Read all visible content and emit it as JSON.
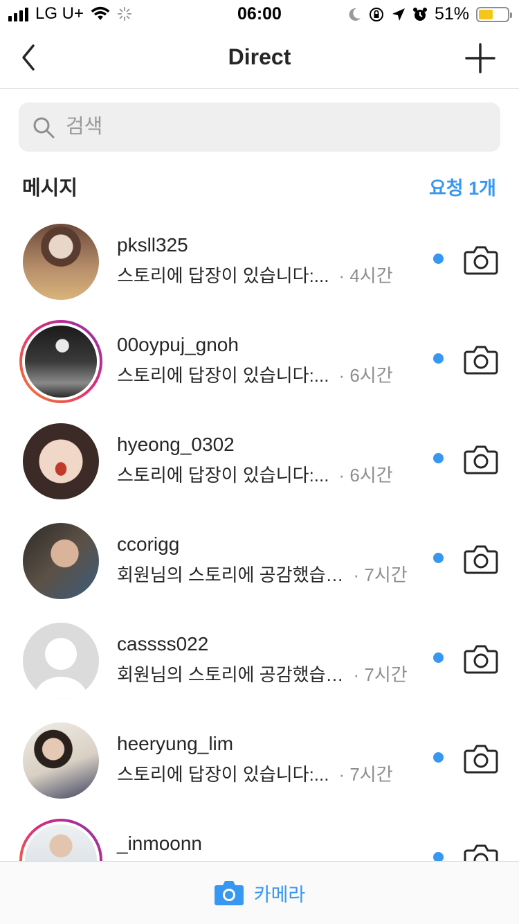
{
  "status_bar": {
    "carrier": "LG U+",
    "time": "06:00",
    "battery": "51%",
    "battery_level": 0.51
  },
  "header": {
    "title": "Direct",
    "back_icon": "chevron-left-icon",
    "add_icon": "plus-icon"
  },
  "search": {
    "placeholder": "검색",
    "value": ""
  },
  "section": {
    "title": "메시지",
    "requests_label": "요청 1개"
  },
  "threads": [
    {
      "username": "pksll325",
      "preview": "스토리에 답장이 있습니다:...",
      "time": "· 4시간",
      "unread": true,
      "story_ring": false
    },
    {
      "username": "00oypuj_gnoh",
      "preview": "스토리에 답장이 있습니다:...",
      "time": "· 6시간",
      "unread": true,
      "story_ring": true
    },
    {
      "username": "hyeong_0302",
      "preview": "스토리에 답장이 있습니다:...",
      "time": "· 6시간",
      "unread": true,
      "story_ring": false
    },
    {
      "username": "ccorigg",
      "preview": "회원님의 스토리에 공감했습…",
      "time": "· 7시간",
      "unread": true,
      "story_ring": false
    },
    {
      "username": "cassss022",
      "preview": "회원님의 스토리에 공감했습…",
      "time": "· 7시간",
      "unread": true,
      "story_ring": false
    },
    {
      "username": "heeryung_lim",
      "preview": "스토리에 답장이 있습니다:...",
      "time": "· 7시간",
      "unread": true,
      "story_ring": false
    },
    {
      "username": "_inmoonn",
      "preview": "",
      "time": "",
      "unread": true,
      "story_ring": true
    }
  ],
  "bottom_bar": {
    "label": "카메라",
    "icon": "camera-icon"
  },
  "colors": {
    "accent": "#3897f0",
    "text": "#262626",
    "secondary_text": "#8e8e8e",
    "divider": "#dbdbdb"
  }
}
